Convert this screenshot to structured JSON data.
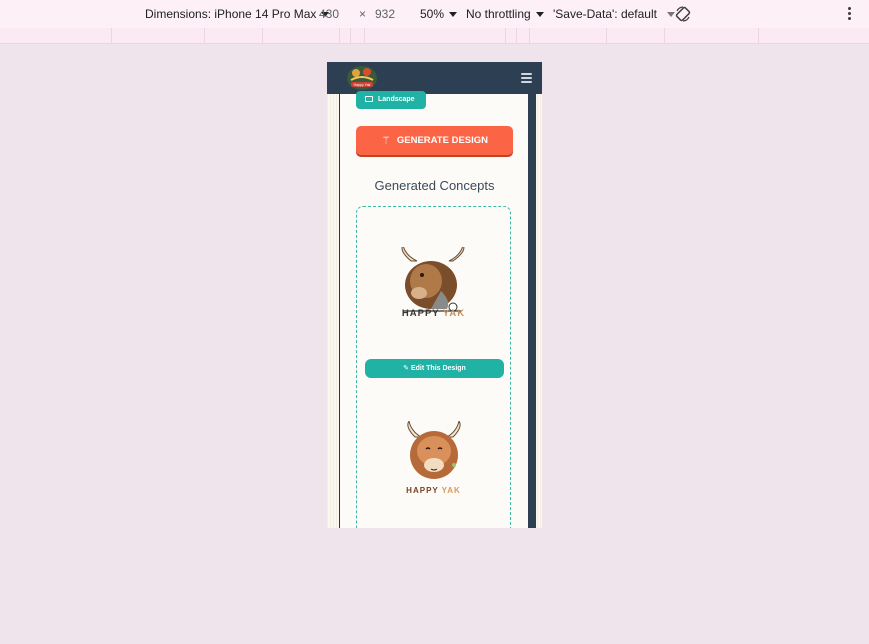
{
  "devtools": {
    "dimensions_label": "Dimensions: iPhone 14 Pro Max",
    "width": "430",
    "times": "×",
    "height": "932",
    "zoom": "50%",
    "throttling": "No throttling",
    "save_data": "'Save-Data': default"
  },
  "app": {
    "logo_text": "Happy Yak",
    "chip_label": "Landscape",
    "generate_label": "GENERATE DESIGN",
    "section_title": "Generated Concepts",
    "concepts": [
      {
        "brand_a": "HAPPY ",
        "brand_b": "YAK",
        "edit_label": "Edit This Design"
      },
      {
        "brand_a": "HAPPY ",
        "brand_b": "YAK"
      }
    ]
  },
  "colors": {
    "appbar": "#2d3f52",
    "accent_teal": "#20b2a5",
    "accent_orange": "#fb6545",
    "page_bg": "#efe3ec"
  },
  "icons": [
    "chevron-down-icon",
    "rotate-icon",
    "more-vert-icon",
    "hamburger-icon",
    "landscape-icon",
    "magic-wand-icon",
    "pencil-icon"
  ]
}
